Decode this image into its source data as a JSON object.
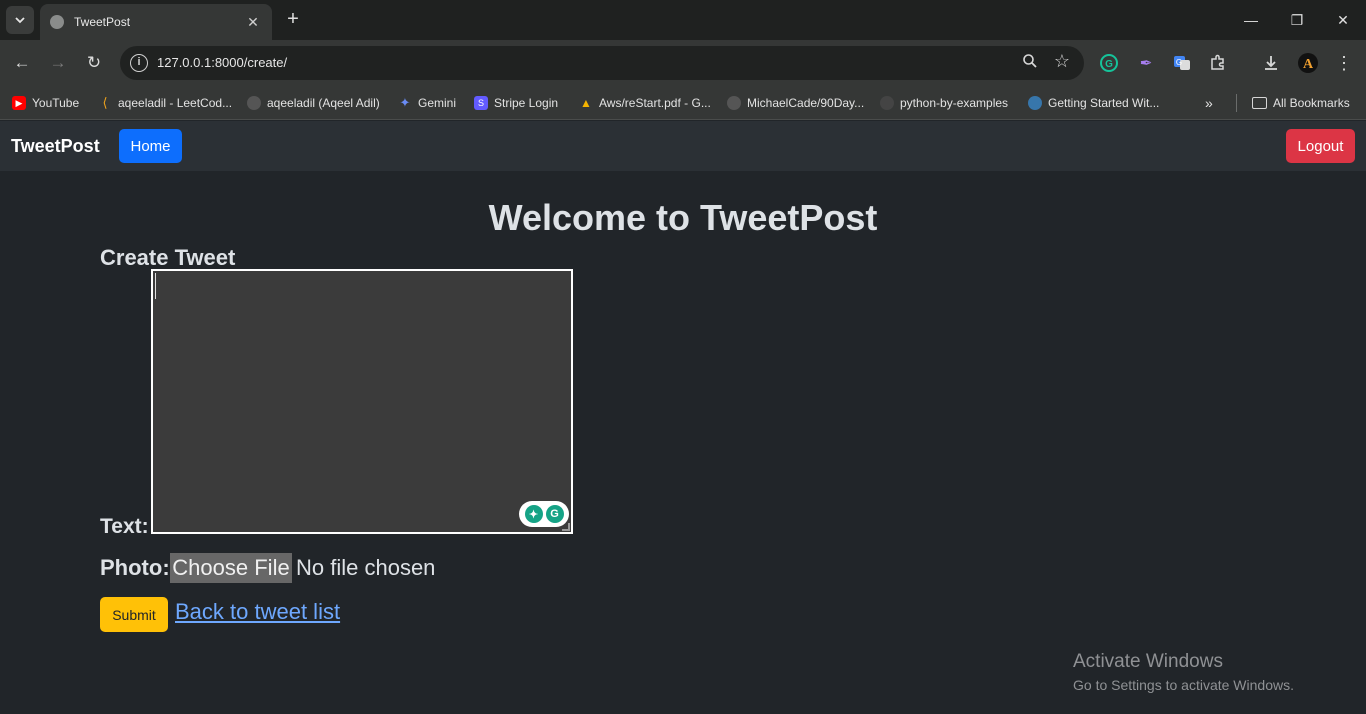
{
  "browser": {
    "tab_title": "TweetPost",
    "url": "127.0.0.1:8000/create/",
    "bookmarks": [
      {
        "label": "YouTube",
        "color": "#ff0000"
      },
      {
        "label": "aqeeladil - LeetCod...",
        "color": "#f0a41c"
      },
      {
        "label": "aqeeladil (Aqeel Adil)",
        "color": "#555555"
      },
      {
        "label": "Gemini",
        "color": "#6a8cf5"
      },
      {
        "label": "Stripe Login",
        "color": "#635bff"
      },
      {
        "label": "Aws/reStart.pdf - G...",
        "color": "#2e8b57"
      },
      {
        "label": "MichaelCade/90Day...",
        "color": "#555555"
      },
      {
        "label": "python-by-examples",
        "color": "#444444"
      },
      {
        "label": "Getting Started Wit...",
        "color": "#3776ab"
      }
    ],
    "all_bookmarks": "All Bookmarks"
  },
  "navbar": {
    "brand": "TweetPost",
    "home": "Home",
    "logout": "Logout"
  },
  "main": {
    "welcome": "Welcome to TweetPost",
    "form_title": "Create Tweet",
    "text_label": "Text:",
    "text_value": "",
    "photo_label": "Photo:",
    "choose_file": "Choose File",
    "file_status": "No file chosen",
    "submit": "Submit",
    "back_link": "Back to tweet list"
  },
  "watermark": {
    "line1": "Activate Windows",
    "line2": "Go to Settings to activate Windows."
  },
  "colors": {
    "primary": "#0d6efd",
    "danger": "#dc3545",
    "warning": "#ffc107",
    "link": "#6ea8fe",
    "background": "#212529"
  }
}
